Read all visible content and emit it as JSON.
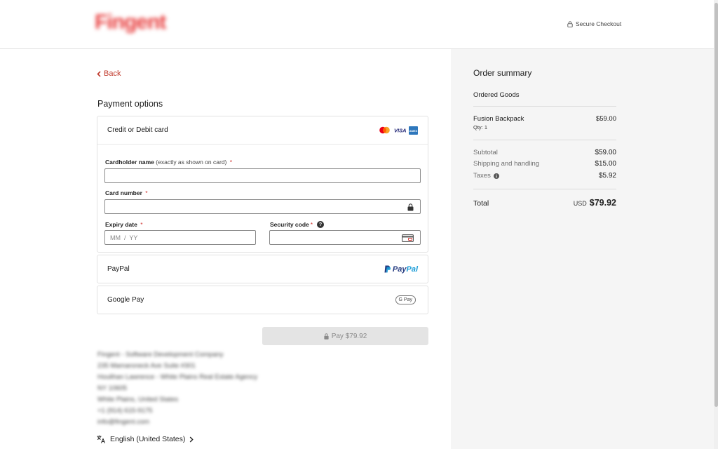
{
  "header": {
    "logo_text": "Fingent",
    "secure_label": "Secure Checkout"
  },
  "nav": {
    "back_label": "Back"
  },
  "payment": {
    "title": "Payment options",
    "card": {
      "label": "Credit or Debit card",
      "brands": [
        "mastercard-icon",
        "visa-icon",
        "amex-icon"
      ],
      "visa_text": "VISA",
      "amex_text": "AMEX",
      "cardholder_label": "Cardholder name",
      "cardholder_hint": "(exactly as shown on card)",
      "cardholder_value": "",
      "card_number_label": "Card number",
      "card_number_value": "",
      "expiry_label": "Expiry date",
      "expiry_placeholder": "MM  /  YY",
      "security_label": "Security code",
      "security_value": "",
      "required_mark": "*",
      "help_mark": "?"
    },
    "paypal": {
      "label": "PayPal",
      "logo_text_a": "Pay",
      "logo_text_b": "Pal"
    },
    "googlepay": {
      "label": "Google Pay",
      "badge": "G Pay"
    },
    "pay_button": "Pay $79.92"
  },
  "footer": {
    "address_lines": [
      "Fingent - Software Development Company",
      "235 Mamaroneck Ave Suite #301",
      "Houlihan Lawrence - White Plains Real Estate Agency",
      "NY 10605",
      "White Plains, United States",
      "+1 (914) 615-9175",
      "info@fingent.com"
    ],
    "language": "English (United States)"
  },
  "summary": {
    "title": "Order summary",
    "subtitle": "Ordered Goods",
    "item": {
      "name": "Fusion Backpack",
      "qty": "Qty: 1",
      "price": "$59.00"
    },
    "subtotal_label": "Subtotal",
    "subtotal_value": "$59.00",
    "shipping_label": "Shipping and handling",
    "shipping_value": "$15.00",
    "taxes_label": "Taxes",
    "taxes_value": "$5.92",
    "total_label": "Total",
    "total_currency": "USD",
    "total_value": "$79.92"
  },
  "colors": {
    "accent": "#c0392b",
    "required": "#d0312d",
    "summary_bg": "#f5f5f5",
    "paypal_dark": "#253b80",
    "paypal_light": "#179bd7"
  }
}
